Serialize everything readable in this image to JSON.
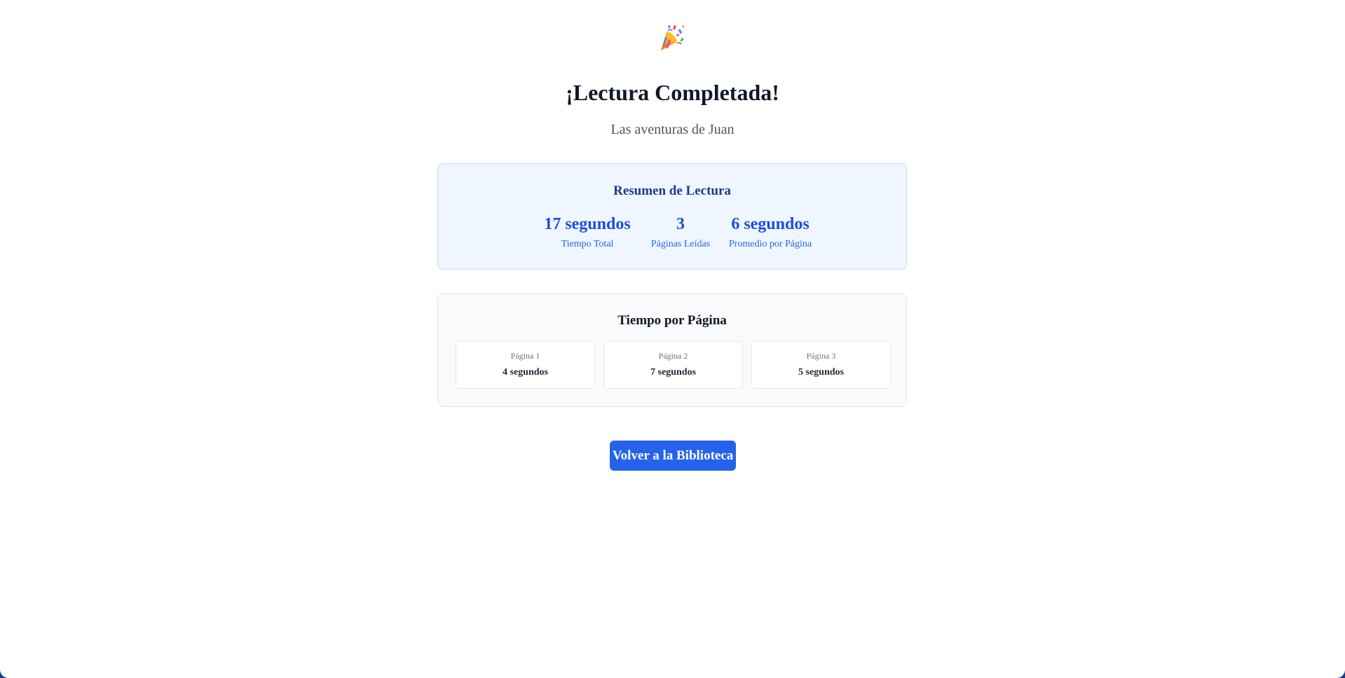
{
  "header": {
    "icon": "party-popper-icon",
    "title": "¡Lectura Completada!",
    "book_title": "Las aventuras de Juan"
  },
  "summary": {
    "title": "Resumen de Lectura",
    "stats": [
      {
        "value": "17 segundos",
        "label": "Tiempo Total"
      },
      {
        "value": "3",
        "label": "Páginas Leídas"
      },
      {
        "value": "6 segundos",
        "label": "Promedio por Página"
      }
    ]
  },
  "page_times": {
    "title": "Tiempo por Página",
    "pages": [
      {
        "label": "Página 1",
        "time": "4 segundos"
      },
      {
        "label": "Página 2",
        "time": "7 segundos"
      },
      {
        "label": "Página 3",
        "time": "5 segundos"
      }
    ]
  },
  "actions": {
    "back_label": "Volver a la Biblioteca"
  },
  "colors": {
    "accent": "#2563eb",
    "summary_bg": "#eff6ff",
    "summary_border": "#bfdbfe",
    "stat_value": "#1d4ed8",
    "heading": "#111827"
  }
}
